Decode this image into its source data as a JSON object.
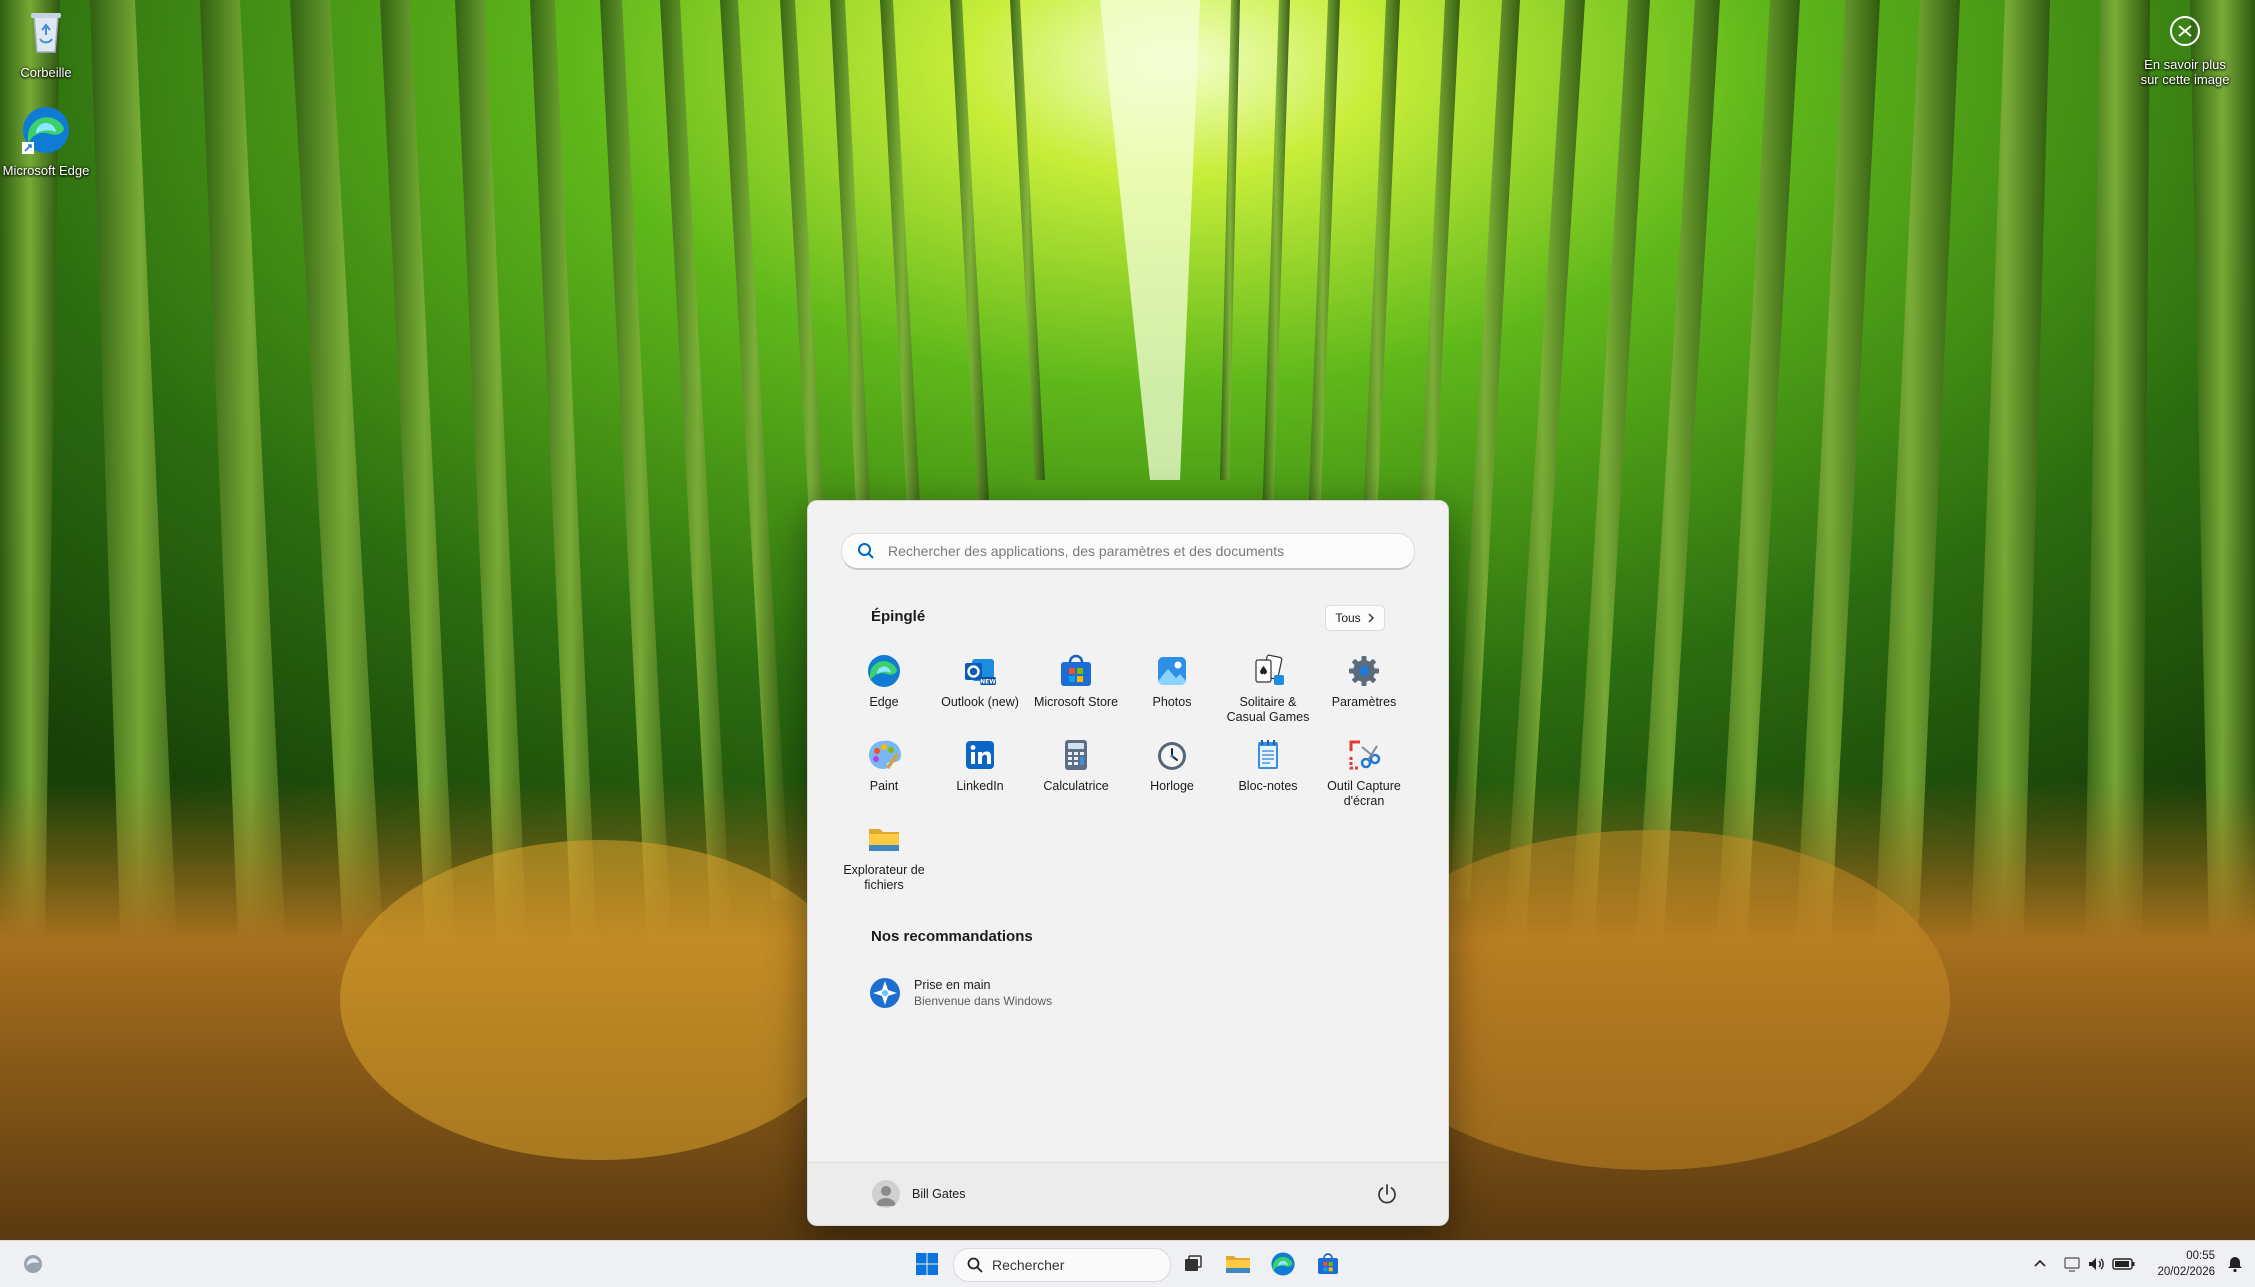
{
  "desktop": {
    "icons": [
      {
        "label": "Corbeille",
        "icon": "recycle-bin-icon"
      },
      {
        "label": "Microsoft Edge",
        "icon": "edge-icon"
      }
    ],
    "about_image": {
      "line1": "En savoir plus",
      "line2": "sur cette image",
      "icon": "camera-icon"
    }
  },
  "start_menu": {
    "search_placeholder": "Rechercher des applications, des paramètres et des documents",
    "pinned_title": "Épinglé",
    "all_button": "Tous",
    "pinned_apps": [
      {
        "label": "Edge",
        "icon": "edge-icon"
      },
      {
        "label": "Outlook (new)",
        "icon": "outlook-icon"
      },
      {
        "label": "Microsoft Store",
        "icon": "store-icon"
      },
      {
        "label": "Photos",
        "icon": "photos-icon"
      },
      {
        "label": "Solitaire & Casual Games",
        "icon": "solitaire-icon"
      },
      {
        "label": "Paramètres",
        "icon": "gear-icon"
      },
      {
        "label": "Paint",
        "icon": "paint-icon"
      },
      {
        "label": "LinkedIn",
        "icon": "linkedin-icon"
      },
      {
        "label": "Calculatrice",
        "icon": "calculator-icon"
      },
      {
        "label": "Horloge",
        "icon": "clock-icon"
      },
      {
        "label": "Bloc-notes",
        "icon": "notepad-icon"
      },
      {
        "label": "Outil Capture d'écran",
        "icon": "snipping-tool-icon"
      },
      {
        "label": "Explorateur de fichiers",
        "icon": "folder-icon"
      }
    ],
    "recommendations_title": "Nos recommandations",
    "recommendations": [
      {
        "title": "Prise en main",
        "subtitle": "Bienvenue dans Windows",
        "icon": "get-started-icon"
      }
    ],
    "user_name": "Bill Gates"
  },
  "taskbar": {
    "search_label": "Rechercher",
    "time": "00:55",
    "date": "20/02/2026"
  },
  "colors": {
    "accent": "#0078d4",
    "start_bg": "#f2f2f2",
    "taskbar_bg": "#eef0f3"
  }
}
